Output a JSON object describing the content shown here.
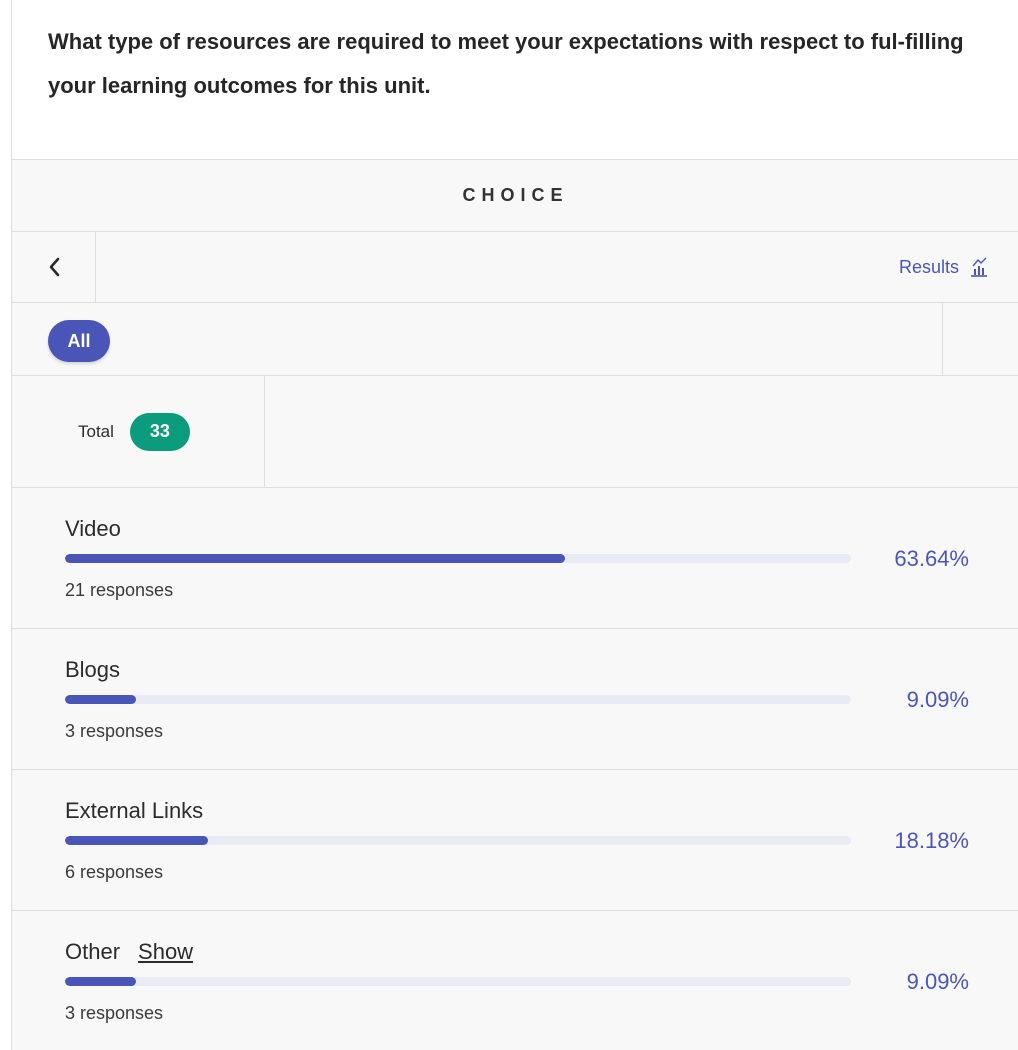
{
  "question": {
    "text": "What type of resources are required to meet your expectations with respect to ful-filling your learning outcomes for this unit."
  },
  "header": {
    "title": "CHOICE"
  },
  "nav": {
    "results_label": "Results"
  },
  "filters": {
    "all_label": "All"
  },
  "total": {
    "label": "Total",
    "count": "33"
  },
  "options": [
    {
      "label": "Video",
      "responses": "21 responses",
      "percent_text": "63.64%",
      "fraction": 0.6364
    },
    {
      "label": "Blogs",
      "responses": "3 responses",
      "percent_text": "9.09%",
      "fraction": 0.0909
    },
    {
      "label": "External Links",
      "responses": "6 responses",
      "percent_text": "18.18%",
      "fraction": 0.1818
    },
    {
      "label": "Other",
      "show_label": "Show",
      "responses": "3 responses",
      "percent_text": "9.09%",
      "fraction": 0.0909
    }
  ],
  "colors": {
    "accent": "#4a55b8",
    "total_badge": "#0c9b7d",
    "track": "#e8eaf4",
    "panel": "#f8f8f9"
  },
  "icons": {
    "back": "chevron-left-icon",
    "results": "bar-chart-icon"
  }
}
